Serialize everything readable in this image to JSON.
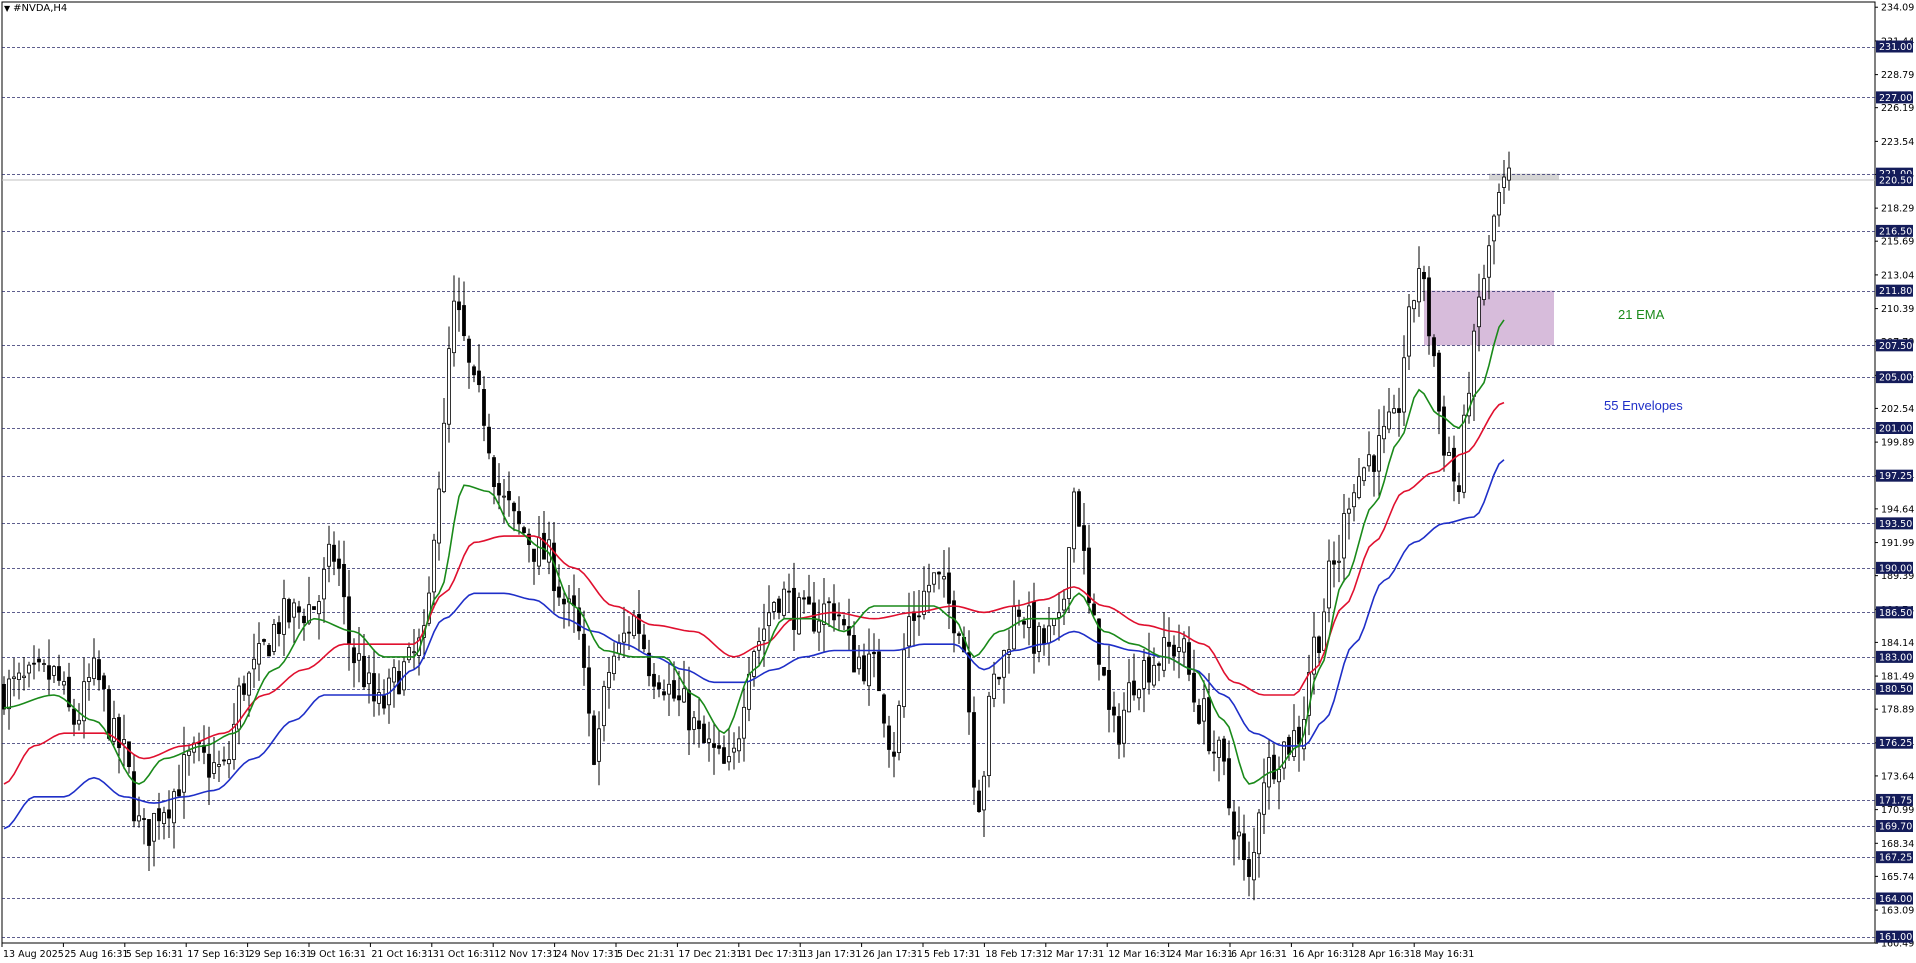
{
  "title": "#NVDA,H4",
  "annotations": {
    "ema": "21 EMA",
    "envelopes": "55 Envelopes"
  },
  "colors": {
    "ema": "#1a8a1a",
    "env_upper": "#e0102f",
    "env_lower": "#1f2fc8",
    "candle": "#000000",
    "level_line": "#2a2a6a",
    "zone_purple": "#c9a6cf",
    "zone_gray": "#cfcfcf",
    "price_box": "#141c5a"
  },
  "chart_data": {
    "type": "candlestick",
    "symbol": "#NVDA",
    "timeframe": "H4",
    "ylim": [
      160.5,
      234.5
    ],
    "grid": false,
    "y_axis_ticks": [
      "234.09",
      "231.44",
      "228.79",
      "226.19",
      "223.54",
      "220.94",
      "218.29",
      "215.69",
      "213.04",
      "210.39",
      "207.79",
      "205.14",
      "202.54",
      "199.89",
      "197.24",
      "194.64",
      "191.99",
      "189.39",
      "186.74",
      "184.14",
      "181.49",
      "178.89",
      "176.24",
      "173.64",
      "170.99",
      "168.34",
      "165.74",
      "163.09",
      "160.49"
    ],
    "level_lines": [
      "231.00",
      "227.00",
      "221.00",
      "216.50",
      "211.80",
      "207.50",
      "205.00",
      "201.00",
      "197.25",
      "193.50",
      "190.00",
      "186.50",
      "183.00",
      "180.50",
      "176.25",
      "171.75",
      "169.70",
      "167.25",
      "164.00",
      "161.00"
    ],
    "current_price": "220.50",
    "x_axis_labels": [
      "13 Aug 2025",
      "25 Aug 16:31",
      "5 Sep 16:31",
      "17 Sep 16:31",
      "29 Sep 16:31",
      "9 Oct 16:31",
      "21 Oct 16:31",
      "31 Oct 16:31",
      "12 Nov 17:31",
      "24 Nov 17:31",
      "5 Dec 21:31",
      "17 Dec 21:31",
      "31 Dec 17:31",
      "13 Jan 17:31",
      "26 Jan 17:31",
      "5 Feb 17:31",
      "18 Feb 17:31",
      "2 Mar 17:31",
      "12 Mar 16:31",
      "24 Mar 16:31",
      "6 Apr 16:31",
      "16 Apr 16:31",
      "28 Apr 16:31",
      "8 May 16:31"
    ],
    "price_anchors": [
      {
        "i": 0,
        "p": 180.5
      },
      {
        "i": 10,
        "p": 181.5
      },
      {
        "i": 14,
        "p": 178
      },
      {
        "i": 18,
        "p": 181.5
      },
      {
        "i": 23,
        "p": 176
      },
      {
        "i": 28,
        "p": 169
      },
      {
        "i": 32,
        "p": 171.5
      },
      {
        "i": 38,
        "p": 175
      },
      {
        "i": 44,
        "p": 174
      },
      {
        "i": 48,
        "p": 181
      },
      {
        "i": 56,
        "p": 186
      },
      {
        "i": 62,
        "p": 187
      },
      {
        "i": 66,
        "p": 191
      },
      {
        "i": 70,
        "p": 183
      },
      {
        "i": 75,
        "p": 179
      },
      {
        "i": 80,
        "p": 182
      },
      {
        "i": 84,
        "p": 184
      },
      {
        "i": 87,
        "p": 197
      },
      {
        "i": 90,
        "p": 210
      },
      {
        "i": 95,
        "p": 203
      },
      {
        "i": 100,
        "p": 195
      },
      {
        "i": 103,
        "p": 193
      },
      {
        "i": 108,
        "p": 191
      },
      {
        "i": 114,
        "p": 186
      },
      {
        "i": 118,
        "p": 176
      },
      {
        "i": 122,
        "p": 183
      },
      {
        "i": 126,
        "p": 186
      },
      {
        "i": 130,
        "p": 182
      },
      {
        "i": 136,
        "p": 179
      },
      {
        "i": 140,
        "p": 176
      },
      {
        "i": 145,
        "p": 174
      },
      {
        "i": 150,
        "p": 184
      },
      {
        "i": 155,
        "p": 188
      },
      {
        "i": 160,
        "p": 186
      },
      {
        "i": 166,
        "p": 187
      },
      {
        "i": 170,
        "p": 183
      },
      {
        "i": 174,
        "p": 182
      },
      {
        "i": 178,
        "p": 176
      },
      {
        "i": 181,
        "p": 186
      },
      {
        "i": 186,
        "p": 189
      },
      {
        "i": 191,
        "p": 186
      },
      {
        "i": 195,
        "p": 172
      },
      {
        "i": 198,
        "p": 181
      },
      {
        "i": 203,
        "p": 187
      },
      {
        "i": 207,
        "p": 184
      },
      {
        "i": 211,
        "p": 185
      },
      {
        "i": 214,
        "p": 196
      },
      {
        "i": 218,
        "p": 185
      },
      {
        "i": 222,
        "p": 177
      },
      {
        "i": 227,
        "p": 182
      },
      {
        "i": 231,
        "p": 183
      },
      {
        "i": 235,
        "p": 184
      },
      {
        "i": 239,
        "p": 179
      },
      {
        "i": 243,
        "p": 175
      },
      {
        "i": 246,
        "p": 170
      },
      {
        "i": 249,
        "p": 165
      },
      {
        "i": 252,
        "p": 174
      },
      {
        "i": 256,
        "p": 176
      },
      {
        "i": 259,
        "p": 177
      },
      {
        "i": 262,
        "p": 184
      },
      {
        "i": 266,
        "p": 190
      },
      {
        "i": 270,
        "p": 197
      },
      {
        "i": 274,
        "p": 199
      },
      {
        "i": 278,
        "p": 201
      },
      {
        "i": 281,
        "p": 209
      },
      {
        "i": 283,
        "p": 214
      },
      {
        "i": 285,
        "p": 209
      },
      {
        "i": 288,
        "p": 200
      },
      {
        "i": 291,
        "p": 196
      },
      {
        "i": 293,
        "p": 205
      },
      {
        "i": 296,
        "p": 213
      },
      {
        "i": 299,
        "p": 219
      },
      {
        "i": 301,
        "p": 220.5
      }
    ],
    "ema_anchors": [
      {
        "i": 0,
        "p": 179
      },
      {
        "i": 10,
        "p": 180
      },
      {
        "i": 18,
        "p": 178
      },
      {
        "i": 27,
        "p": 173
      },
      {
        "i": 32,
        "p": 175
      },
      {
        "i": 40,
        "p": 176
      },
      {
        "i": 46,
        "p": 177
      },
      {
        "i": 54,
        "p": 182
      },
      {
        "i": 62,
        "p": 186
      },
      {
        "i": 70,
        "p": 185
      },
      {
        "i": 76,
        "p": 183
      },
      {
        "i": 82,
        "p": 183
      },
      {
        "i": 87,
        "p": 188
      },
      {
        "i": 92,
        "p": 196.5
      },
      {
        "i": 97,
        "p": 196
      },
      {
        "i": 102,
        "p": 193
      },
      {
        "i": 108,
        "p": 191.5
      },
      {
        "i": 114,
        "p": 187
      },
      {
        "i": 120,
        "p": 183.5
      },
      {
        "i": 126,
        "p": 183
      },
      {
        "i": 132,
        "p": 183
      },
      {
        "i": 138,
        "p": 180
      },
      {
        "i": 144,
        "p": 177
      },
      {
        "i": 150,
        "p": 182
      },
      {
        "i": 156,
        "p": 186
      },
      {
        "i": 162,
        "p": 186
      },
      {
        "i": 168,
        "p": 185
      },
      {
        "i": 174,
        "p": 187
      },
      {
        "i": 180,
        "p": 187
      },
      {
        "i": 186,
        "p": 187
      },
      {
        "i": 190,
        "p": 186
      },
      {
        "i": 194,
        "p": 183
      },
      {
        "i": 199,
        "p": 185
      },
      {
        "i": 205,
        "p": 186
      },
      {
        "i": 211,
        "p": 186
      },
      {
        "i": 215,
        "p": 188
      },
      {
        "i": 220,
        "p": 185
      },
      {
        "i": 226,
        "p": 184
      },
      {
        "i": 232,
        "p": 183
      },
      {
        "i": 238,
        "p": 182
      },
      {
        "i": 244,
        "p": 178
      },
      {
        "i": 249,
        "p": 173
      },
      {
        "i": 254,
        "p": 174
      },
      {
        "i": 259,
        "p": 176
      },
      {
        "i": 263,
        "p": 182
      },
      {
        "i": 268,
        "p": 189
      },
      {
        "i": 274,
        "p": 195
      },
      {
        "i": 279,
        "p": 200
      },
      {
        "i": 283,
        "p": 204
      },
      {
        "i": 287,
        "p": 202
      },
      {
        "i": 291,
        "p": 201
      },
      {
        "i": 295,
        "p": 204
      },
      {
        "i": 300,
        "p": 209.5
      }
    ],
    "env_upper_anchors": [
      {
        "i": 0,
        "p": 173
      },
      {
        "i": 6,
        "p": 176
      },
      {
        "i": 12,
        "p": 177
      },
      {
        "i": 20,
        "p": 177
      },
      {
        "i": 28,
        "p": 175
      },
      {
        "i": 36,
        "p": 176
      },
      {
        "i": 44,
        "p": 177
      },
      {
        "i": 52,
        "p": 180
      },
      {
        "i": 60,
        "p": 182
      },
      {
        "i": 68,
        "p": 184
      },
      {
        "i": 76,
        "p": 184
      },
      {
        "i": 82,
        "p": 184
      },
      {
        "i": 88,
        "p": 188
      },
      {
        "i": 94,
        "p": 192
      },
      {
        "i": 100,
        "p": 192.5
      },
      {
        "i": 106,
        "p": 192.5
      },
      {
        "i": 114,
        "p": 190
      },
      {
        "i": 122,
        "p": 187
      },
      {
        "i": 130,
        "p": 185.5
      },
      {
        "i": 138,
        "p": 185
      },
      {
        "i": 146,
        "p": 183
      },
      {
        "i": 152,
        "p": 184
      },
      {
        "i": 158,
        "p": 186
      },
      {
        "i": 166,
        "p": 186.5
      },
      {
        "i": 174,
        "p": 186
      },
      {
        "i": 182,
        "p": 186.5
      },
      {
        "i": 190,
        "p": 187
      },
      {
        "i": 196,
        "p": 186.5
      },
      {
        "i": 202,
        "p": 187
      },
      {
        "i": 208,
        "p": 187.5
      },
      {
        "i": 214,
        "p": 188.5
      },
      {
        "i": 220,
        "p": 187
      },
      {
        "i": 228,
        "p": 185.5
      },
      {
        "i": 234,
        "p": 185
      },
      {
        "i": 240,
        "p": 184
      },
      {
        "i": 246,
        "p": 181
      },
      {
        "i": 252,
        "p": 180
      },
      {
        "i": 258,
        "p": 180
      },
      {
        "i": 262,
        "p": 182
      },
      {
        "i": 268,
        "p": 187
      },
      {
        "i": 274,
        "p": 192
      },
      {
        "i": 280,
        "p": 196
      },
      {
        "i": 286,
        "p": 197.5
      },
      {
        "i": 292,
        "p": 199
      },
      {
        "i": 300,
        "p": 203
      }
    ],
    "env_lower_anchors": [
      {
        "i": 0,
        "p": 169.5
      },
      {
        "i": 6,
        "p": 172
      },
      {
        "i": 12,
        "p": 172
      },
      {
        "i": 18,
        "p": 173.5
      },
      {
        "i": 24,
        "p": 172
      },
      {
        "i": 30,
        "p": 171.5
      },
      {
        "i": 36,
        "p": 172
      },
      {
        "i": 42,
        "p": 172.5
      },
      {
        "i": 50,
        "p": 175
      },
      {
        "i": 58,
        "p": 178
      },
      {
        "i": 64,
        "p": 180
      },
      {
        "i": 70,
        "p": 180
      },
      {
        "i": 76,
        "p": 180
      },
      {
        "i": 82,
        "p": 182
      },
      {
        "i": 88,
        "p": 186
      },
      {
        "i": 94,
        "p": 188
      },
      {
        "i": 100,
        "p": 188
      },
      {
        "i": 106,
        "p": 187.5
      },
      {
        "i": 112,
        "p": 186
      },
      {
        "i": 118,
        "p": 185
      },
      {
        "i": 124,
        "p": 184
      },
      {
        "i": 130,
        "p": 183
      },
      {
        "i": 136,
        "p": 182
      },
      {
        "i": 142,
        "p": 181
      },
      {
        "i": 148,
        "p": 181
      },
      {
        "i": 154,
        "p": 182
      },
      {
        "i": 160,
        "p": 183
      },
      {
        "i": 166,
        "p": 183.5
      },
      {
        "i": 172,
        "p": 183.5
      },
      {
        "i": 178,
        "p": 183.5
      },
      {
        "i": 184,
        "p": 184
      },
      {
        "i": 190,
        "p": 184
      },
      {
        "i": 196,
        "p": 182
      },
      {
        "i": 202,
        "p": 183.5
      },
      {
        "i": 208,
        "p": 184
      },
      {
        "i": 214,
        "p": 185
      },
      {
        "i": 220,
        "p": 184
      },
      {
        "i": 226,
        "p": 183.5
      },
      {
        "i": 232,
        "p": 183
      },
      {
        "i": 238,
        "p": 182
      },
      {
        "i": 244,
        "p": 180
      },
      {
        "i": 250,
        "p": 177
      },
      {
        "i": 256,
        "p": 176
      },
      {
        "i": 260,
        "p": 176
      },
      {
        "i": 264,
        "p": 178
      },
      {
        "i": 270,
        "p": 184
      },
      {
        "i": 276,
        "p": 189
      },
      {
        "i": 282,
        "p": 192
      },
      {
        "i": 288,
        "p": 193.5
      },
      {
        "i": 294,
        "p": 194
      },
      {
        "i": 300,
        "p": 198.5
      }
    ],
    "zones": [
      {
        "name": "purple-zone",
        "p_low": 207.5,
        "p_high": 211.8,
        "i_start": 284,
        "i_end": 310
      },
      {
        "name": "gray-zone",
        "p_low": 220.5,
        "p_high": 221.0,
        "i_start": 297,
        "i_end": 311
      }
    ],
    "bar_count": 302
  }
}
